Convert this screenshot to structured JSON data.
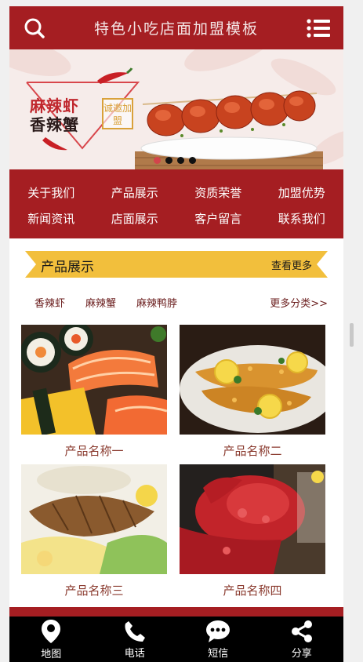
{
  "header": {
    "title": "特色小吃店面加盟模板",
    "search_icon": "search-icon",
    "menu_icon": "menu-icon"
  },
  "banner": {
    "line1": "麻辣虾",
    "line2": "香辣蟹",
    "seal": "诚邀加盟",
    "slide_count": 4,
    "active_slide": 1
  },
  "nav": [
    {
      "label": "关于我们"
    },
    {
      "label": "产品展示"
    },
    {
      "label": "资质荣誉"
    },
    {
      "label": "加盟优势"
    },
    {
      "label": "新闻资讯"
    },
    {
      "label": "店面展示"
    },
    {
      "label": "客户留言"
    },
    {
      "label": "联系我们"
    }
  ],
  "products_section": {
    "title": "产品展示",
    "more": "查看更多",
    "categories": [
      "香辣虾",
      "麻辣蟹",
      "麻辣鸭脖"
    ],
    "more_categories": "更多分类>>",
    "items": [
      {
        "name": "产品名称一"
      },
      {
        "name": "产品名称二"
      },
      {
        "name": "产品名称三"
      },
      {
        "name": "产品名称四"
      }
    ]
  },
  "bottom_bar": [
    {
      "label": "地图",
      "icon": "map-pin-icon"
    },
    {
      "label": "电话",
      "icon": "phone-icon"
    },
    {
      "label": "短信",
      "icon": "message-icon"
    },
    {
      "label": "分享",
      "icon": "share-icon"
    }
  ],
  "colors": {
    "brand_red": "#a51e22",
    "accent_yellow": "#f2bf3c"
  }
}
